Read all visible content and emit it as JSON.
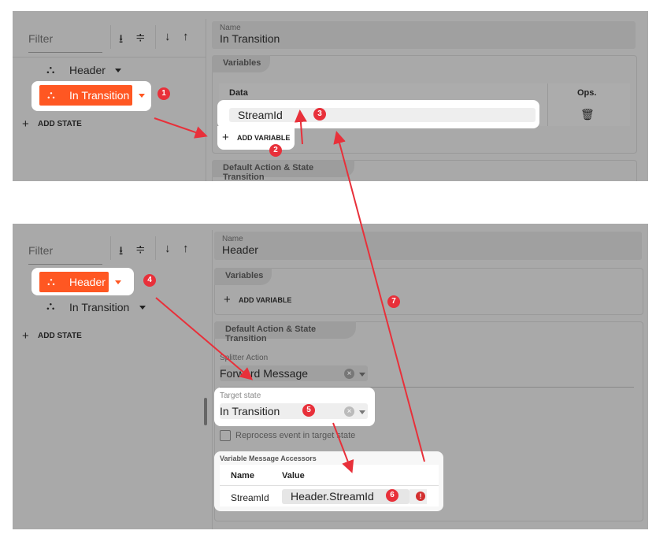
{
  "accent": "#ff5722",
  "annotation_color": "#e8303a",
  "top": {
    "filter_placeholder": "Filter",
    "states": [
      {
        "label": "Header"
      },
      {
        "label": "In Transition",
        "selected": true
      }
    ],
    "add_state": "ADD STATE",
    "name_label": "Name",
    "name_value": "In Transition",
    "variables_tab": "Variables",
    "col_data": "Data",
    "col_ops": "Ops.",
    "variable": "StreamId",
    "add_variable": "ADD VARIABLE",
    "default_tab": "Default Action & State Transition"
  },
  "bottom": {
    "filter_placeholder": "Filter",
    "states": [
      {
        "label": "Header",
        "selected": true
      },
      {
        "label": "In Transition"
      }
    ],
    "add_state": "ADD STATE",
    "name_label": "Name",
    "name_value": "Header",
    "variables_tab": "Variables",
    "add_variable": "ADD VARIABLE",
    "default_tab": "Default Action & State Transition",
    "splitter_label": "Splitter Action",
    "splitter_value": "Forward Message",
    "target_label": "Target state",
    "target_value": "In Transition",
    "reprocess_label": "Reprocess event in target state",
    "reprocess_checked": false,
    "accessors_title": "Variable Message Accessors",
    "col_name": "Name",
    "col_value": "Value",
    "accessor_name": "StreamId",
    "accessor_value": "Header.StreamId"
  },
  "badges": [
    "1",
    "2",
    "3",
    "4",
    "5",
    "6",
    "7"
  ]
}
